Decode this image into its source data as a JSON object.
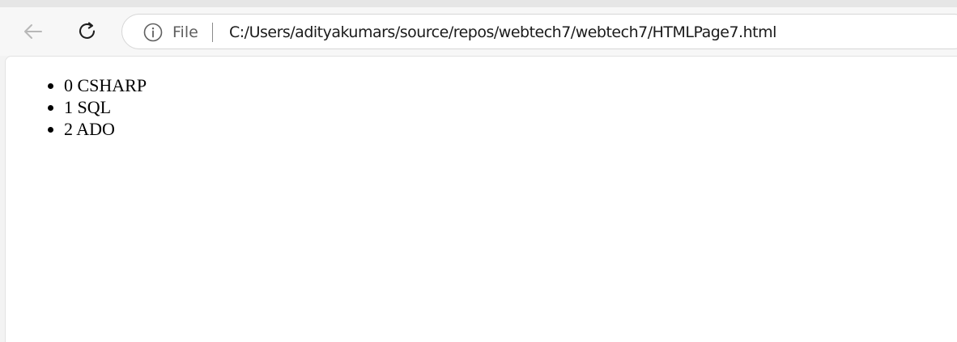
{
  "browser": {
    "back_icon": "arrow-left-icon",
    "reload_icon": "reload-icon",
    "info_icon": "info-icon",
    "scheme_label": "File",
    "url": "C:/Users/adityakumars/source/repos/webtech7/webtech7/HTMLPage7.html"
  },
  "page": {
    "items": [
      {
        "text": "0 CSHARP"
      },
      {
        "text": "1 SQL"
      },
      {
        "text": "2 ADO"
      }
    ]
  }
}
